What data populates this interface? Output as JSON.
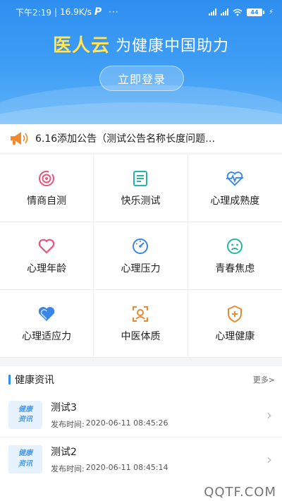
{
  "status_bar": {
    "time": "下午2:19",
    "speed": "16.9K/s",
    "app_badge": "P",
    "dots": "···",
    "battery": "44"
  },
  "banner": {
    "logo": "医人云",
    "slogan": "为健康中国助力",
    "login_button": "立即登录"
  },
  "notice": {
    "text": "6.16添加公告（测试公告名称长度问题…"
  },
  "grid": [
    {
      "label": "情商自测",
      "icon": "target-icon",
      "color": "#e8547a"
    },
    {
      "label": "快乐测试",
      "icon": "document-icon",
      "color": "#26b5a4"
    },
    {
      "label": "心理成熟度",
      "icon": "heart-pulse-icon",
      "color": "#3a86e8"
    },
    {
      "label": "心理年龄",
      "icon": "heart-outline-icon",
      "color": "#e8547a"
    },
    {
      "label": "心理压力",
      "icon": "gauge-icon",
      "color": "#3a86e8"
    },
    {
      "label": "青春焦虑",
      "icon": "sad-face-icon",
      "color": "#26b5a4"
    },
    {
      "label": "心理适应力",
      "icon": "heart-fill-icon",
      "color": "#3a86e8"
    },
    {
      "label": "中医体质",
      "icon": "face-scan-icon",
      "color": "#e88a34"
    },
    {
      "label": "心理健康",
      "icon": "shield-plus-icon",
      "color": "#e88a34"
    }
  ],
  "news": {
    "title": "健康资讯",
    "more": "更多>",
    "thumb_line1": "健康",
    "thumb_line2": "资讯",
    "date_prefix": "发布时间:",
    "items": [
      {
        "title": "测试3",
        "date": "2020-06-11 08:45:26"
      },
      {
        "title": "测试2",
        "date": "2020-06-11 08:45:14"
      }
    ]
  },
  "watermark": "QQTF.COM",
  "colors": {
    "primary": "#2f8ff0",
    "logo_yellow": "#ffe45c",
    "notice_orange": "#f08a2c"
  }
}
